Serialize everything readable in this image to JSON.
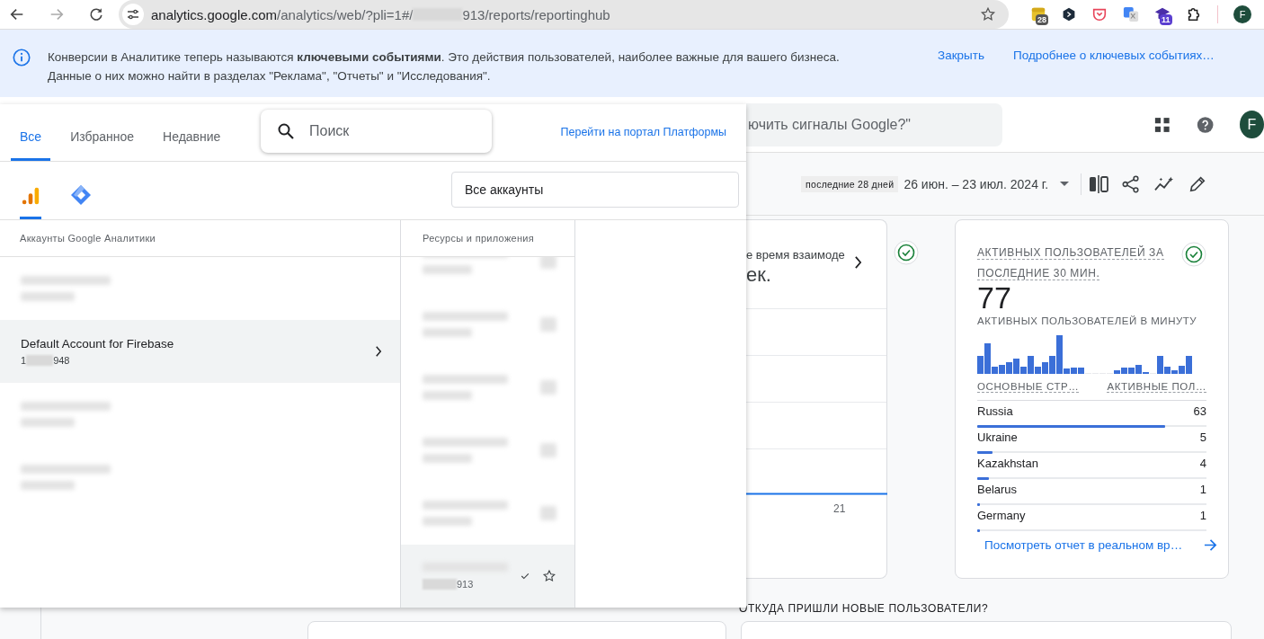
{
  "browser": {
    "forward_disabled": true,
    "address": {
      "host": "analytics.google.com",
      "path_start": "/analytics/web/?pli=1#/",
      "path_end": "913/reports/reportinghub"
    },
    "extensions": [
      {
        "kind": "notes",
        "badge": "28"
      },
      {
        "kind": "hex"
      },
      {
        "kind": "pocket"
      },
      {
        "kind": "translate"
      },
      {
        "kind": "cap",
        "badge": "11"
      },
      {
        "kind": "puzzle"
      }
    ],
    "profile": "F"
  },
  "banner": {
    "lines": [
      "Конверсии в Аналитике теперь называются **ключевыми событиями**. Это действия пользователей, наиболее важные для вашего бизнеса.",
      "Данные о них можно найти в разделах \"Реклама\", \"Отчеты\" и \"Исследования\"."
    ],
    "close": "Закрыть",
    "more": "Подробнее о ключевых событиях…"
  },
  "header": {
    "search_text": "ючить сигналы Google?\"",
    "avatar": "F"
  },
  "toolbar": {
    "range_chip": "последние 28 дней",
    "dates": "26 июн. – 23 июл. 2024 г."
  },
  "card_partial": {
    "title": "е время взаимоде",
    "value": "ек.",
    "x_label": "21",
    "verified": true
  },
  "realtime": {
    "title_lines": [
      "АКТИВНЫХ ПОЛЬЗОВАТЕЛЕЙ ЗА",
      "ПОСЛЕДНИЕ 30 МИН."
    ],
    "value": "77",
    "subtitle": "АКТИВНЫХ ПОЛЬЗОВАТЕЛЕЙ В МИНУТУ",
    "verified": true,
    "columns": [
      "ОСНОВНЫЕ СТР…",
      "АКТИВНЫЕ ПОЛ…"
    ],
    "rows": [
      {
        "country": "Russia",
        "users": "63",
        "level": 0.82
      },
      {
        "country": "Ukraine",
        "users": "5",
        "level": 0.065
      },
      {
        "country": "Kazakhstan",
        "users": "4",
        "level": 0.052
      },
      {
        "country": "Belarus",
        "users": "1",
        "level": 0.013
      },
      {
        "country": "Germany",
        "users": "1",
        "level": 0.013
      }
    ],
    "link": "Посмотреть отчет в реальном вр…"
  },
  "section_heading": "ОТКУДА ПРИШЛИ НОВЫЕ ПОЛЬЗОВАТЕЛИ?",
  "picker": {
    "tabs": [
      {
        "label": "Все",
        "selected": true
      },
      {
        "label": "Избранное",
        "selected": false
      },
      {
        "label": "Недавние",
        "selected": false
      }
    ],
    "search_placeholder": "Поиск",
    "portal_link": "Перейти на портал Платформы",
    "products": [
      {
        "kind": "analytics",
        "selected": true
      },
      {
        "kind": "tag_manager",
        "selected": false
      }
    ],
    "account_filter": "Все аккаунты",
    "accounts_heading": "Аккаунты Google Аналитики",
    "properties_heading": "Ресурсы и приложения",
    "accounts": [
      {
        "kind": "redacted",
        "selected": false
      },
      {
        "kind": "account",
        "name": "Default Account for Firebase",
        "id_prefix": "1",
        "id_suffix": "948",
        "selected": true
      },
      {
        "kind": "redacted",
        "selected": false
      },
      {
        "kind": "redacted",
        "selected": false
      }
    ],
    "properties": [
      {
        "kind": "redacted",
        "selected": false
      },
      {
        "kind": "redacted",
        "selected": false
      },
      {
        "kind": "redacted",
        "selected": false
      },
      {
        "kind": "redacted",
        "selected": false
      },
      {
        "kind": "redacted",
        "selected": false
      },
      {
        "kind": "property",
        "id_suffix": "913",
        "selected": true
      }
    ]
  }
}
